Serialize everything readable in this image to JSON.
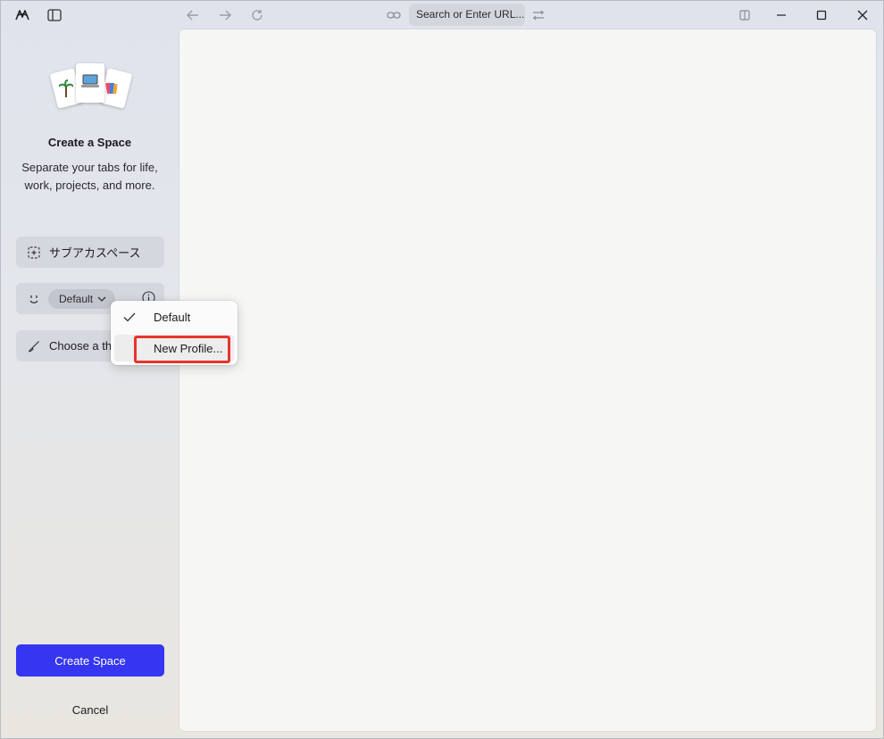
{
  "toolbar": {
    "url_placeholder": "Search or Enter URL..."
  },
  "sidebar": {
    "title": "Create a Space",
    "subtitle": "Separate your tabs for life, work, projects, and more.",
    "space_name": "サブアカスペース",
    "profile": {
      "selected": "Default"
    },
    "theme_label": "Choose a theme",
    "create_label": "Create Space",
    "cancel_label": "Cancel"
  },
  "profile_menu": {
    "items": [
      {
        "label": "Default",
        "checked": true
      },
      {
        "label": "New Profile..."
      }
    ]
  },
  "colors": {
    "primary_button": "#3535f2",
    "highlight": "#e8342c"
  }
}
